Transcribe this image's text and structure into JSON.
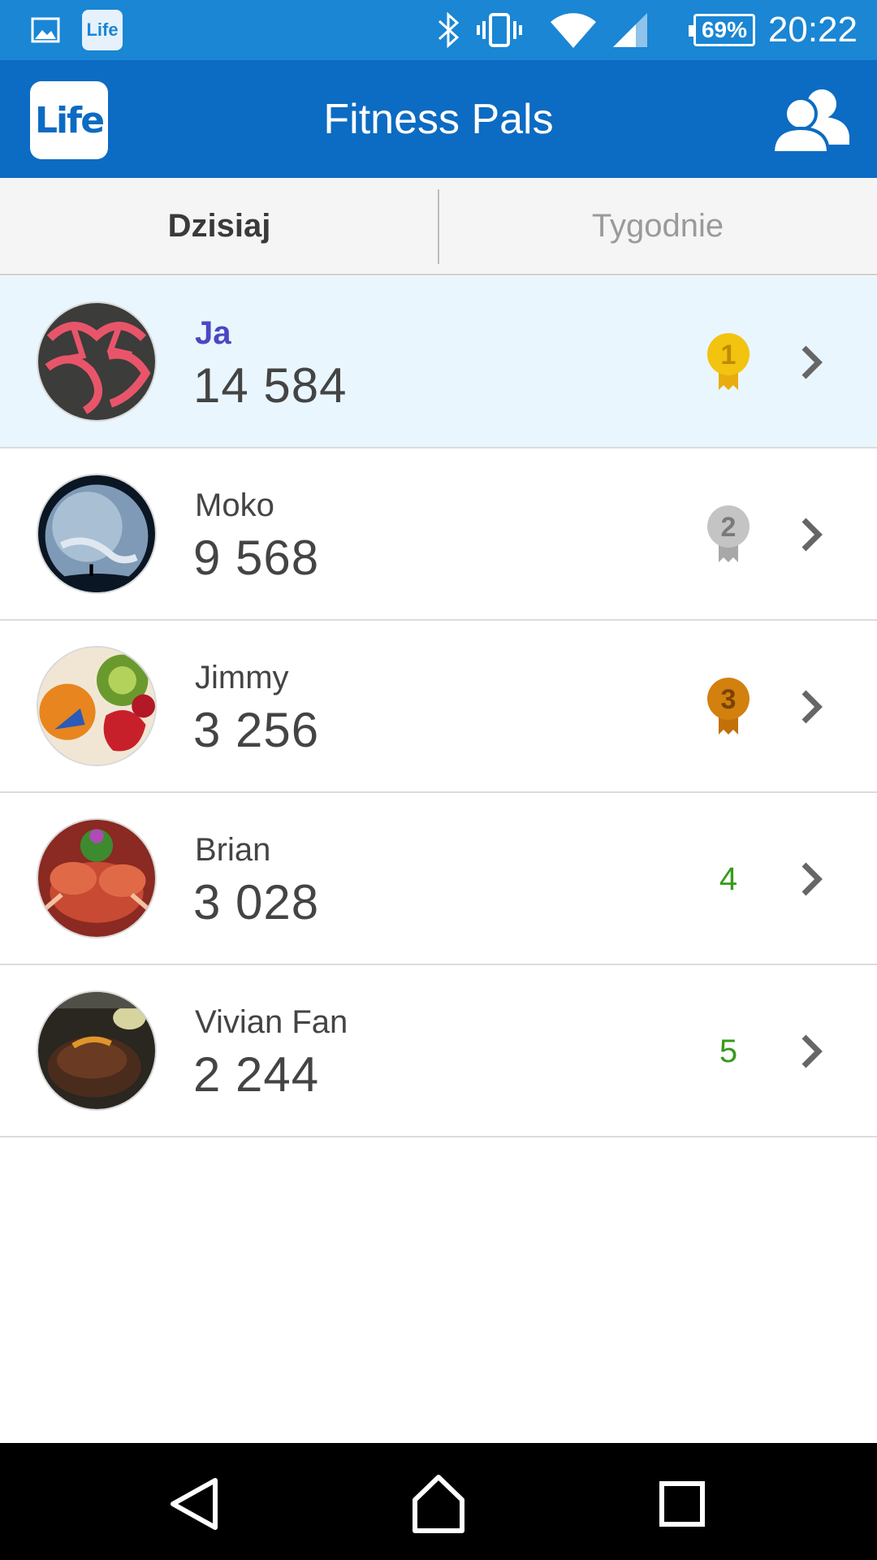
{
  "status_bar": {
    "time": "20:22",
    "battery": "69%",
    "left_icons": [
      "image-icon",
      "life-app-icon"
    ],
    "right_icons": [
      "bluetooth-icon",
      "vibrate-icon",
      "wifi-icon",
      "signal-icon",
      "battery-icon"
    ]
  },
  "app_bar": {
    "logo_text": "Life",
    "title": "Fitness Pals",
    "action_icon": "friends-icon"
  },
  "tabs": [
    {
      "label": "Dzisiaj",
      "selected": true
    },
    {
      "label": "Tygodnie",
      "selected": false
    }
  ],
  "friends": [
    {
      "name": "Ja",
      "steps": "14 584",
      "rank": "1",
      "medal": "gold",
      "highlight": true
    },
    {
      "name": "Moko",
      "steps": "9 568",
      "rank": "2",
      "medal": "silver",
      "highlight": false
    },
    {
      "name": "Jimmy",
      "steps": "3 256",
      "rank": "3",
      "medal": "bronze",
      "highlight": false
    },
    {
      "name": "Brian",
      "steps": "3 028",
      "rank": "4",
      "medal": "none",
      "highlight": false
    },
    {
      "name": "Vivian Fan",
      "steps": "2 244",
      "rank": "5",
      "medal": "none",
      "highlight": false
    }
  ],
  "colors": {
    "status_bar": "#1a86d4",
    "app_bar": "#0c6bc2",
    "highlight_row": "#e9f6fd",
    "me_name": "#4a48c2",
    "rank_text": "#3a9a1c",
    "medal_gold": "#f2c30f",
    "medal_silver": "#b8b8b8",
    "medal_bronze": "#d2800e"
  },
  "nav_bar": {
    "icons": [
      "back-icon",
      "home-icon",
      "recents-icon"
    ]
  }
}
